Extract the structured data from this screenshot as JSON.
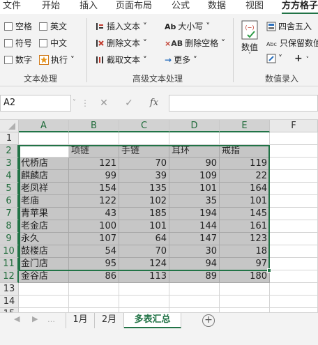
{
  "tabs": [
    "文件",
    "开始",
    "插入",
    "页面布局",
    "公式",
    "数据",
    "视图",
    "方方格子"
  ],
  "ribbon": {
    "text_group": {
      "label": "文本处理",
      "checkboxes": [
        "空格",
        "英文",
        "符号",
        "中文",
        "数字"
      ],
      "execute": "执行"
    },
    "adv_group": {
      "label": "高级文本处理",
      "items": [
        "插入文本",
        "删除文本",
        "截取文本",
        "大小写",
        "删除空格",
        "更多"
      ]
    },
    "num_group": {
      "label": "数值录入",
      "value_btn": "数值",
      "round_btn": "四舍五入",
      "keep_btn": "只保留数值"
    }
  },
  "formula_bar": {
    "name_box": "A2",
    "fx": "fx",
    "value": ""
  },
  "sheet": {
    "columns": [
      "A",
      "B",
      "C",
      "D",
      "E",
      "F"
    ],
    "rows": [
      "1",
      "2",
      "3",
      "4",
      "5",
      "6",
      "7",
      "8",
      "9",
      "10",
      "11",
      "12",
      "13",
      "14",
      "15"
    ],
    "headers": [
      "",
      "项链",
      "手链",
      "耳环",
      "戒指"
    ],
    "data": [
      [
        "代桥店",
        "121",
        "70",
        "90",
        "119"
      ],
      [
        "麒麟店",
        "99",
        "39",
        "109",
        "22"
      ],
      [
        "老凤祥",
        "154",
        "135",
        "101",
        "164"
      ],
      [
        "老庙",
        "122",
        "102",
        "35",
        "101"
      ],
      [
        "青苹果",
        "43",
        "185",
        "194",
        "145"
      ],
      [
        "老金店",
        "100",
        "101",
        "144",
        "161"
      ],
      [
        "永久",
        "107",
        "64",
        "147",
        "123"
      ],
      [
        "鼓楼店",
        "54",
        "70",
        "30",
        "18"
      ],
      [
        "金门店",
        "95",
        "124",
        "94",
        "97"
      ],
      [
        "金谷店",
        "86",
        "113",
        "89",
        "180"
      ]
    ]
  },
  "sheet_tabs": [
    "1月",
    "2月",
    "多表汇总"
  ],
  "active_sheet": "多表汇总",
  "colors": {
    "accent": "#217346",
    "data_fill": "#c6c6c6"
  }
}
